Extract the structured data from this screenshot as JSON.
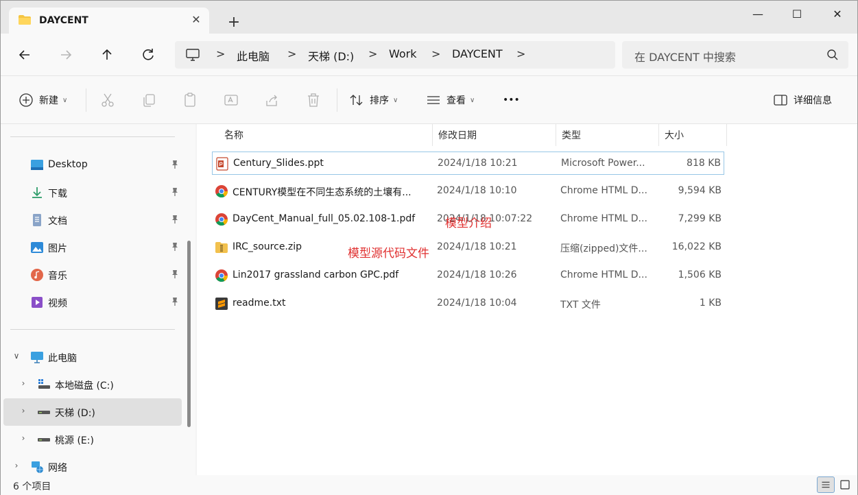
{
  "window": {
    "tab_title": "DAYCENT",
    "tab_close": "✕",
    "new_tab": "+",
    "minimize": "—",
    "maximize": "☐",
    "close": "✕"
  },
  "address": {
    "crumbs": [
      "此电脑",
      "天梯 (D:)",
      "Work",
      "DAYCENT"
    ],
    "separator": ">",
    "search_placeholder": "在 DAYCENT 中搜索"
  },
  "commands": {
    "new_label": "新建",
    "sort_label": "排序",
    "view_label": "查看",
    "more_label": "•••",
    "details_label": "详细信息"
  },
  "sidebar": {
    "quick_access": [
      {
        "label": "Desktop",
        "icon": "desktop-icon"
      },
      {
        "label": "下载",
        "icon": "download-icon"
      },
      {
        "label": "文档",
        "icon": "document-icon"
      },
      {
        "label": "图片",
        "icon": "pictures-icon"
      },
      {
        "label": "音乐",
        "icon": "music-icon"
      },
      {
        "label": "视频",
        "icon": "video-icon"
      }
    ],
    "this_pc": "此电脑",
    "drives": [
      {
        "label": "本地磁盘 (C:)"
      },
      {
        "label": "天梯 (D:)"
      },
      {
        "label": "桃源 (E:)"
      }
    ],
    "network": "网络",
    "expand_open": "∨",
    "expand_closed": "›"
  },
  "columns": {
    "name": "名称",
    "date": "修改日期",
    "type": "类型",
    "size": "大小",
    "sort_indicator": "^"
  },
  "files": [
    {
      "name": "Century_Slides.ppt",
      "date": "2024/1/18 10:21",
      "type": "Microsoft Power...",
      "size": "818 KB",
      "icon": "ppt-icon"
    },
    {
      "name": "CENTURY模型在不同生态系统的土壤有...",
      "date": "2024/1/18 10:10",
      "type": "Chrome HTML D...",
      "size": "9,594 KB",
      "icon": "chrome-icon"
    },
    {
      "name": "DayCent_Manual_full_05.02.108-1.pdf",
      "date": "2024/1/18 10:07:22",
      "type": "Chrome HTML D...",
      "size": "7,299 KB",
      "icon": "chrome-icon"
    },
    {
      "name": "IRC_source.zip",
      "date": "2024/1/18 10:21",
      "type": "压缩(zipped)文件...",
      "size": "16,022 KB",
      "icon": "zip-icon"
    },
    {
      "name": "Lin2017 grassland carbon GPC.pdf",
      "date": "2024/1/18 10:26",
      "type": "Chrome HTML D...",
      "size": "1,506 KB",
      "icon": "chrome-icon"
    },
    {
      "name": "readme.txt",
      "date": "2024/1/18 10:04",
      "type": "TXT 文件",
      "size": "1 KB",
      "icon": "sublime-icon"
    }
  ],
  "annotations": {
    "model_intro": "模型介绍",
    "model_source": "模型源代码文件"
  },
  "status": {
    "count": "6 个项目"
  }
}
